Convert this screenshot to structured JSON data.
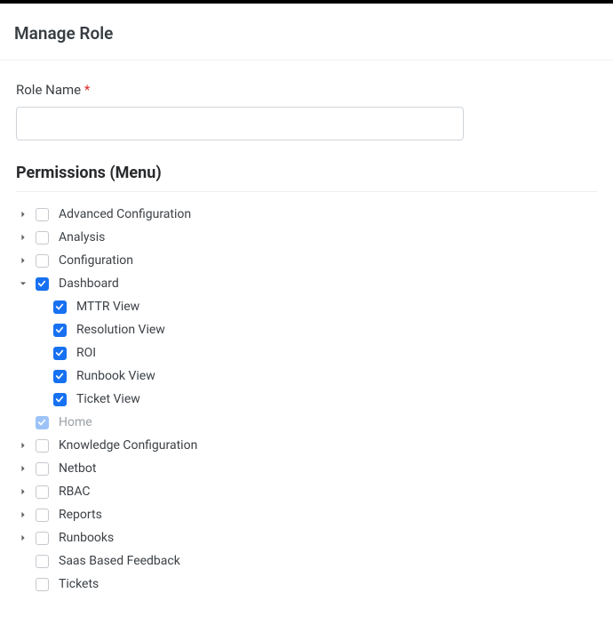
{
  "header": {
    "title": "Manage Role"
  },
  "role_name": {
    "label": "Role Name",
    "required_mark": "*",
    "value": ""
  },
  "permissions": {
    "heading": "Permissions (Menu)",
    "nodes": [
      {
        "label": "Advanced Configuration",
        "expandable": true,
        "expanded": false,
        "checked": false,
        "children": []
      },
      {
        "label": "Analysis",
        "expandable": true,
        "expanded": false,
        "checked": false,
        "children": []
      },
      {
        "label": "Configuration",
        "expandable": true,
        "expanded": false,
        "checked": false,
        "children": []
      },
      {
        "label": "Dashboard",
        "expandable": true,
        "expanded": true,
        "checked": true,
        "children": [
          {
            "label": "MTTR View",
            "expandable": false,
            "expanded": false,
            "checked": true,
            "children": []
          },
          {
            "label": "Resolution View",
            "expandable": false,
            "expanded": false,
            "checked": true,
            "children": []
          },
          {
            "label": "ROI",
            "expandable": false,
            "expanded": false,
            "checked": true,
            "children": []
          },
          {
            "label": "Runbook View",
            "expandable": false,
            "expanded": false,
            "checked": true,
            "children": []
          },
          {
            "label": "Ticket View",
            "expandable": false,
            "expanded": false,
            "checked": true,
            "children": []
          }
        ]
      },
      {
        "label": "Home",
        "expandable": false,
        "expanded": false,
        "checked": true,
        "disabled": true,
        "children": []
      },
      {
        "label": "Knowledge Configuration",
        "expandable": true,
        "expanded": false,
        "checked": false,
        "children": []
      },
      {
        "label": "Netbot",
        "expandable": true,
        "expanded": false,
        "checked": false,
        "children": []
      },
      {
        "label": "RBAC",
        "expandable": true,
        "expanded": false,
        "checked": false,
        "children": []
      },
      {
        "label": "Reports",
        "expandable": true,
        "expanded": false,
        "checked": false,
        "children": []
      },
      {
        "label": "Runbooks",
        "expandable": true,
        "expanded": false,
        "checked": false,
        "children": []
      },
      {
        "label": "Saas Based Feedback",
        "expandable": false,
        "expanded": false,
        "checked": false,
        "children": []
      },
      {
        "label": "Tickets",
        "expandable": false,
        "expanded": false,
        "checked": false,
        "children": []
      }
    ]
  }
}
